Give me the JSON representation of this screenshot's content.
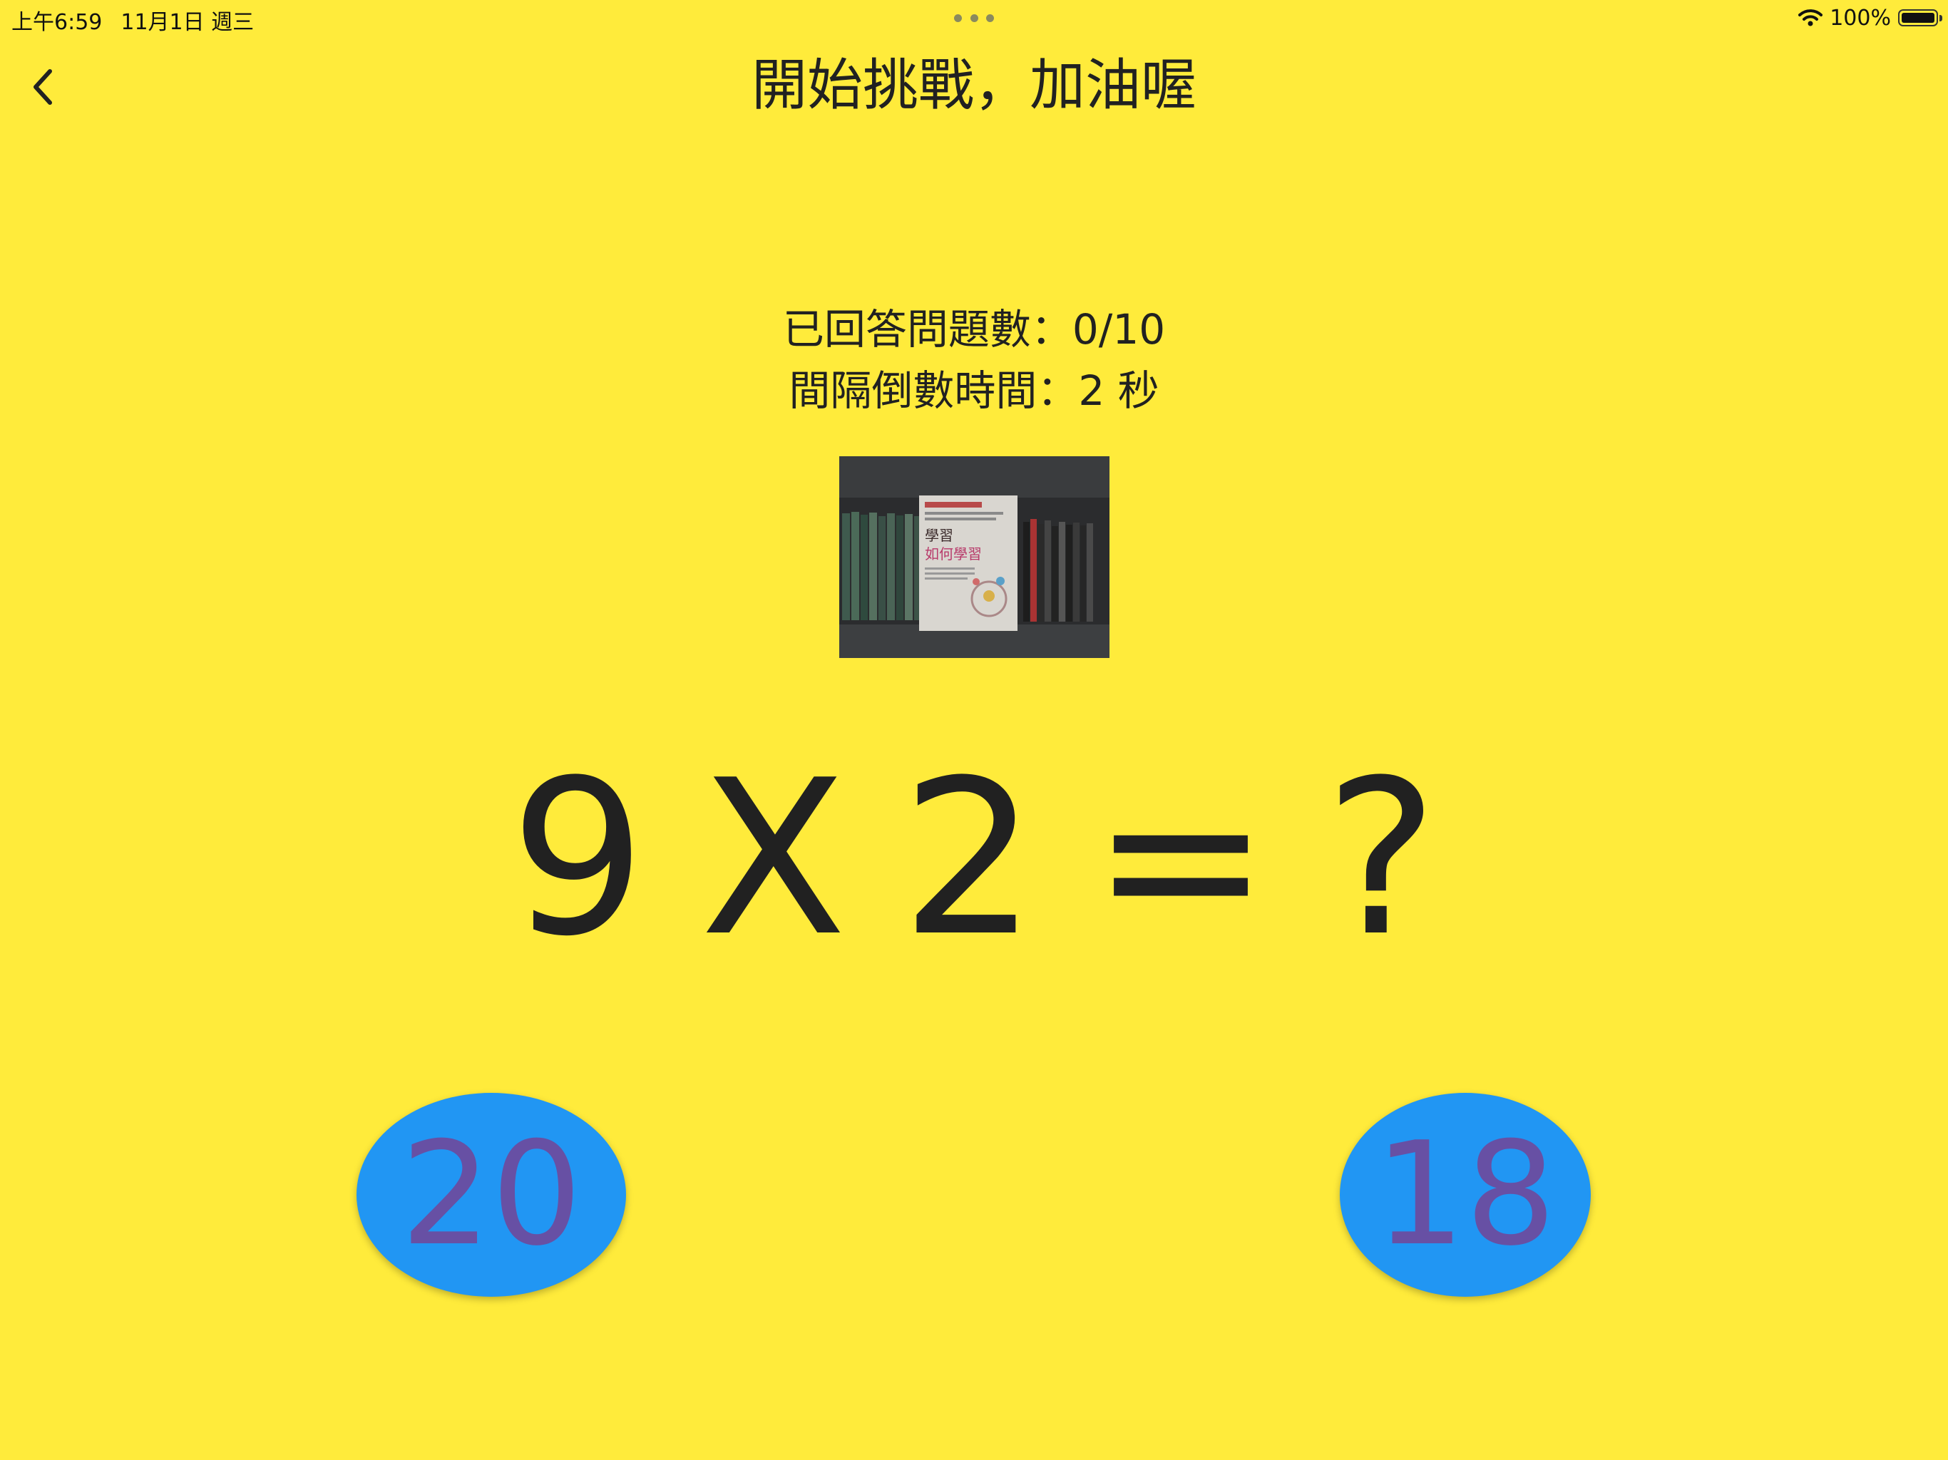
{
  "status_bar": {
    "time": "上午6:59",
    "date": "11月1日 週三",
    "battery": "100%",
    "battery_level": 1.0
  },
  "app_bar": {
    "title": "開始挑戰，加油喔"
  },
  "info": {
    "answered": "已回答問題數：0/10",
    "countdown": "間隔倒數時間：2 秒"
  },
  "photo": {
    "book_title_line1": "學習",
    "book_title_line2": "如何學習"
  },
  "question": {
    "operand1": "9",
    "operator": "X",
    "operand2": "2",
    "equals": "=",
    "unknown": "?"
  },
  "answers": {
    "left": "20",
    "right": "18"
  },
  "colors": {
    "background": "#FFEB3B",
    "button": "#2196F3",
    "button_text": "#6750A4",
    "text": "#212121"
  }
}
